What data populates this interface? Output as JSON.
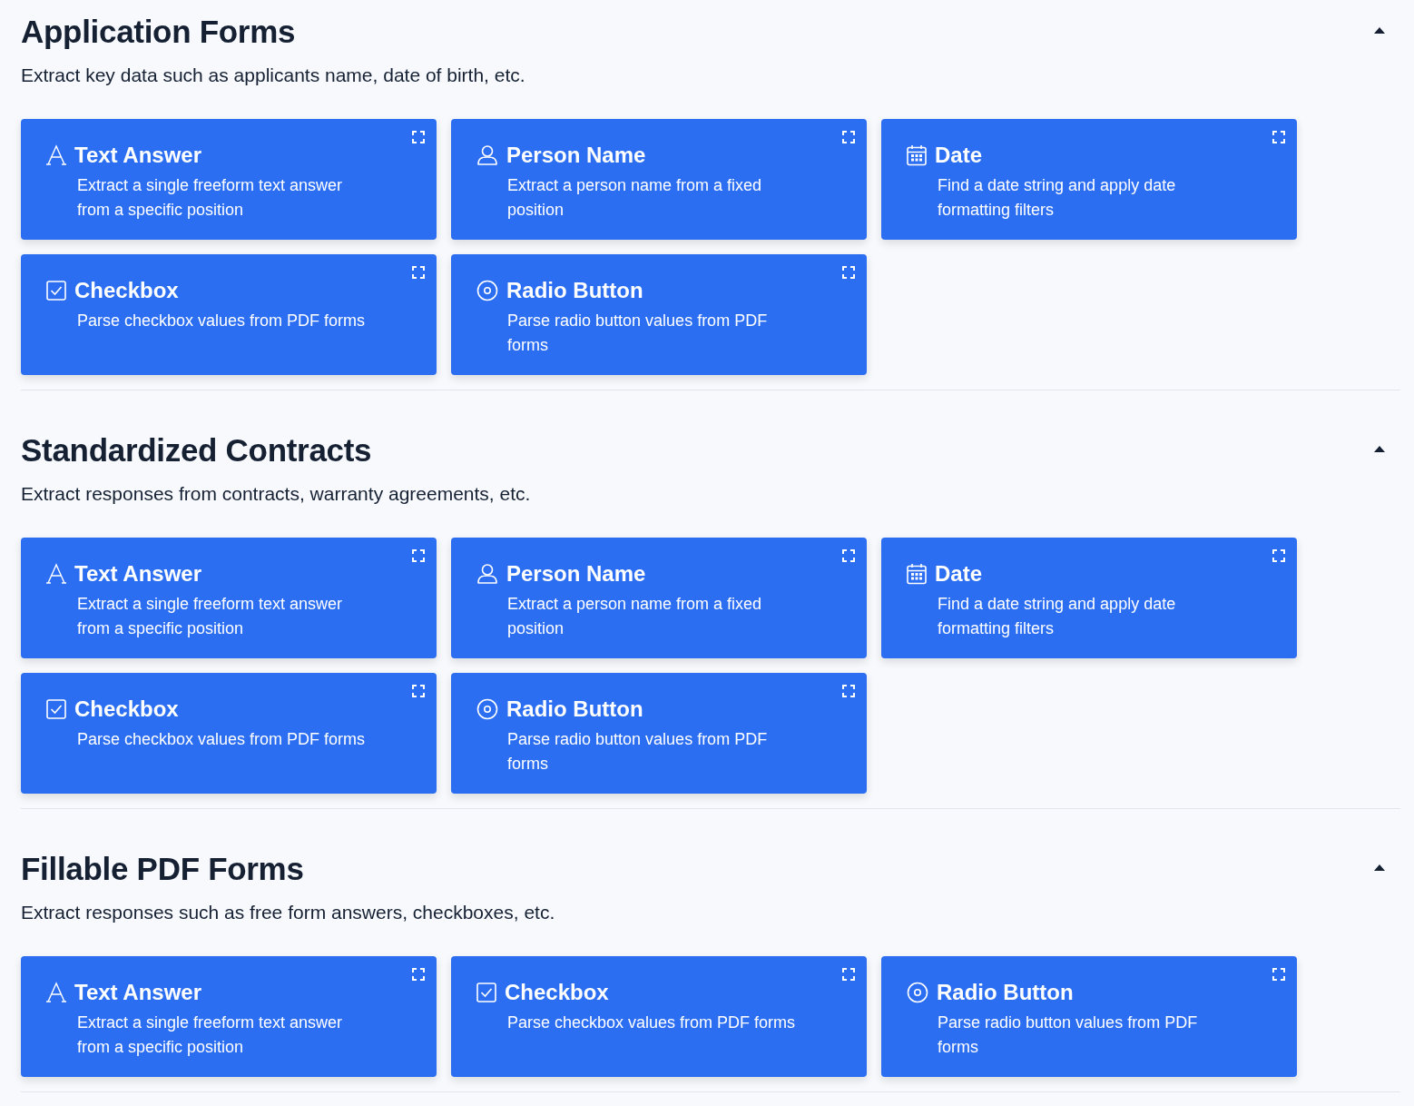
{
  "sections": [
    {
      "title": "Application Forms",
      "description": "Extract key data such as applicants name, date of birth, etc.",
      "expanded": true,
      "cards": [
        {
          "kind": "text",
          "title": "Text Answer",
          "description": "Extract a single freeform text answer from a specific position"
        },
        {
          "kind": "person",
          "title": "Person Name",
          "description": "Extract a person name from a fixed position"
        },
        {
          "kind": "date",
          "title": "Date",
          "description": "Find a date string and apply date formatting filters"
        },
        {
          "kind": "checkbox",
          "title": "Checkbox",
          "description": "Parse checkbox values from PDF forms"
        },
        {
          "kind": "radio",
          "title": "Radio Button",
          "description": "Parse radio button values from PDF forms"
        }
      ]
    },
    {
      "title": "Standardized Contracts",
      "description": "Extract responses from contracts, warranty agreements, etc.",
      "expanded": true,
      "cards": [
        {
          "kind": "text",
          "title": "Text Answer",
          "description": "Extract a single freeform text answer from a specific position"
        },
        {
          "kind": "person",
          "title": "Person Name",
          "description": "Extract a person name from a fixed position"
        },
        {
          "kind": "date",
          "title": "Date",
          "description": "Find a date string and apply date formatting filters"
        },
        {
          "kind": "checkbox",
          "title": "Checkbox",
          "description": "Parse checkbox values from PDF forms"
        },
        {
          "kind": "radio",
          "title": "Radio Button",
          "description": "Parse radio button values from PDF forms"
        }
      ]
    },
    {
      "title": "Fillable PDF Forms",
      "description": "Extract responses such as free form answers, checkboxes, etc.",
      "expanded": true,
      "cards": [
        {
          "kind": "text",
          "title": "Text Answer",
          "description": "Extract a single freeform text answer from a specific position"
        },
        {
          "kind": "checkbox",
          "title": "Checkbox",
          "description": "Parse checkbox values from PDF forms"
        },
        {
          "kind": "radio",
          "title": "Radio Button",
          "description": "Parse radio button values from PDF forms"
        }
      ]
    }
  ]
}
